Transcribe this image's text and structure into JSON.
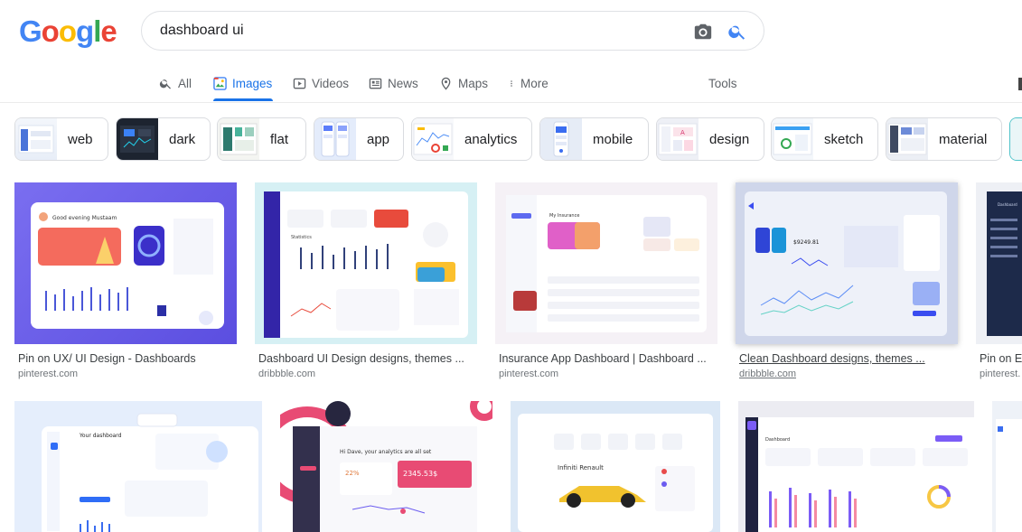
{
  "logo": {
    "letters": [
      "G",
      "o",
      "o",
      "g",
      "l",
      "e"
    ],
    "colors": [
      "#4285F4",
      "#EA4335",
      "#FBBC05",
      "#4285F4",
      "#34A853",
      "#EA4335"
    ]
  },
  "search": {
    "query": "dashboard ui"
  },
  "tabs": [
    {
      "label": "All",
      "icon": "search-icon"
    },
    {
      "label": "Images",
      "icon": "image-icon",
      "active": true
    },
    {
      "label": "Videos",
      "icon": "video-icon"
    },
    {
      "label": "News",
      "icon": "news-icon"
    },
    {
      "label": "Maps",
      "icon": "map-pin-icon"
    },
    {
      "label": "More",
      "icon": "more-vertical-icon"
    },
    {
      "label": "Tools"
    }
  ],
  "chips": [
    {
      "label": "web"
    },
    {
      "label": "dark"
    },
    {
      "label": "flat"
    },
    {
      "label": "app"
    },
    {
      "label": "analytics"
    },
    {
      "label": "mobile"
    },
    {
      "label": "design"
    },
    {
      "label": "sketch"
    },
    {
      "label": "material"
    }
  ],
  "results_row1": [
    {
      "title": "Pin on UX/ UI Design - Dashboards",
      "source": "pinterest.com",
      "thumb_text": "Good evening Mustaam"
    },
    {
      "title": "Dashboard UI Design designs, themes ...",
      "source": "dribbble.com",
      "thumb_text": "Statistics"
    },
    {
      "title": "Insurance App Dashboard | Dashboard ...",
      "source": "pinterest.com",
      "thumb_text": "My Insurance"
    },
    {
      "title": "Clean Dashboard designs, themes ...",
      "source": "dribbble.com",
      "thumb_text": "$9249.81"
    },
    {
      "title": "Pin on Er",
      "source": "pinterest.",
      "thumb_text": "Dashboard"
    }
  ],
  "results_row2": [
    {
      "thumb_text": "Your dashboard"
    },
    {
      "thumb_text": "Hi Dave, your analytics are all set",
      "amount": "2345.53$",
      "pct": "22%"
    },
    {
      "thumb_text": "Infiniti Renault"
    },
    {
      "thumb_text": "Dashboard"
    },
    {
      "thumb_text": ""
    }
  ]
}
